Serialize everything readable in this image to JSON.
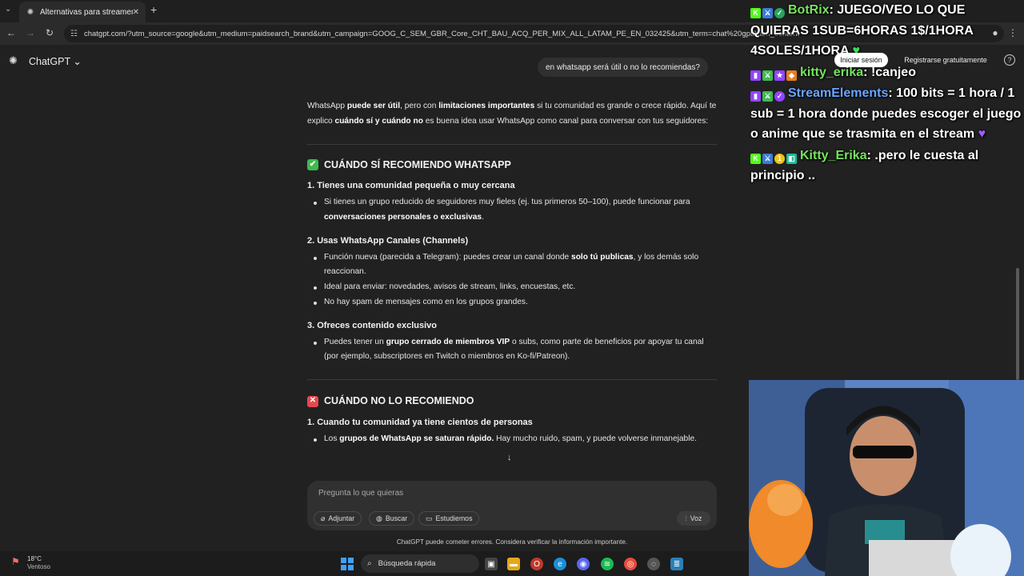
{
  "browser": {
    "tab_title": "Alternativas para streamers",
    "url": "chatgpt.com/?utm_source=google&utm_medium=paidsearch_brand&utm_campaign=GOOG_C_SEM_GBR_Core_CHT_BAU_ACQ_PER_MIX_ALL_LATAM_PE_EN_032425&utm_term=chat%20gpt&utm_content"
  },
  "header": {
    "app_name": "ChatGPT",
    "login": "Iniciar sesión",
    "register": "Registrarse gratuitamente",
    "help": "?"
  },
  "conversation": {
    "user_message": "en whatsapp será útil o no lo recomiendas?",
    "intro": {
      "p1": "WhatsApp ",
      "b1": "puede ser útil",
      "p2": ", pero con ",
      "b2": "limitaciones importantes",
      "p3": " si tu comunidad es grande o crece rápido. Aquí te explico ",
      "b3": "cuándo sí y cuándo no",
      "p4": " es buena idea usar WhatsApp como canal para conversar con tus seguidores:"
    },
    "section_yes": {
      "emoji": "✔",
      "title": "CUÁNDO SÍ RECOMIENDO WHATSAPP",
      "h1": "1. Tienes una comunidad pequeña o muy cercana",
      "h1_b1_text": "Si tienes un grupo reducido de seguidores muy fieles (ej. tus primeros 50–100), puede funcionar para ",
      "h1_b1_bold": "conversaciones personales o exclusivas",
      "h1_b1_end": ".",
      "h2": "2. Usas WhatsApp Canales (Channels)",
      "h2_b1_text": "Función nueva (parecida a Telegram): puedes crear un canal donde ",
      "h2_b1_bold": "solo tú publicas",
      "h2_b1_end": ", y los demás solo reaccionan.",
      "h2_b2": "Ideal para enviar: novedades, avisos de stream, links, encuestas, etc.",
      "h2_b3": "No hay spam de mensajes como en los grupos grandes.",
      "h3": "3. Ofreces contenido exclusivo",
      "h3_b1_text": "Puedes tener un ",
      "h3_b1_bold": "grupo cerrado de miembros VIP",
      "h3_b1_end": " o subs, como parte de beneficios por apoyar tu canal (por ejemplo, subscriptores en Twitch o miembros en Ko-fi/Patreon)."
    },
    "section_no": {
      "emoji": "✕",
      "title": "CUÁNDO NO LO RECOMIENDO",
      "h1": "1. Cuando tu comunidad ya tiene cientos de personas",
      "h1_b1_pre": "Los ",
      "h1_b1_bold": "grupos de WhatsApp se saturan rápido.",
      "h1_b1_end": " Hay mucho ruido, spam, y puede volverse inmanejable."
    }
  },
  "composer": {
    "placeholder": "Pregunta lo que quieras",
    "attach": "Adjuntar",
    "search": "Buscar",
    "study": "Estudiemos",
    "voice": "Voz",
    "disclaimer": "ChatGPT puede cometer errores. Considera verificar la información importante."
  },
  "stream_chat": [
    {
      "user": "BotRix",
      "color": "#76e35f",
      "text": ": JUEGO/VEO LO QUE QUIERAS 1SUB=6HORAS 1$/1HORA 4SOLES/1HORA"
    },
    {
      "user": "kitty_erika",
      "color": "#76e35f",
      "text": ": !canjeo"
    },
    {
      "user": "StreamElements",
      "color": "#6aa5ff",
      "text": ": 100 bits = 1 hora / 1 sub = 1 hora donde puedes escoger el juego o anime que se trasmita en el stream"
    },
    {
      "user": "Kitty_Erika",
      "color": "#76e35f",
      "text": ": .pero le cuesta al principio .."
    }
  ],
  "taskbar": {
    "temp": "18°C",
    "weather": "Ventoso",
    "search": "Búsqueda rápida"
  },
  "colors": {
    "check_green": "#3fb950",
    "cross_red": "#e5484d",
    "accent_blue": "#3ea0ff"
  }
}
